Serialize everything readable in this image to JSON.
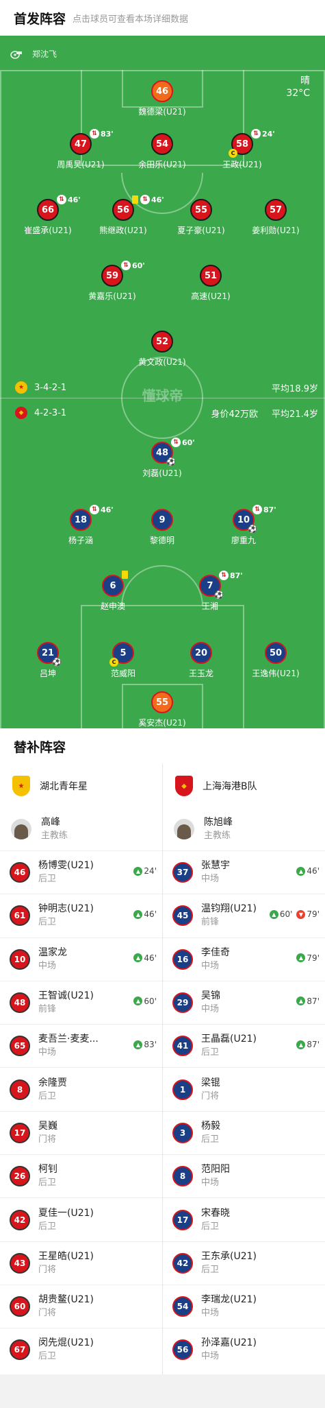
{
  "starting": {
    "title": "首发阵容",
    "hint": "点击球员可查看本场详细数据"
  },
  "referee": {
    "name": "郑沈飞"
  },
  "weather": {
    "condition": "晴",
    "temp": "32°C"
  },
  "home_formation": {
    "shape": "3-4-2-1",
    "avg_age": "平均18.9岁"
  },
  "away_formation": {
    "shape": "4-2-3-1",
    "value": "身价42万欧",
    "avg_age": "平均21.4岁"
  },
  "watermark": "懂球帝",
  "pitch_players": [
    {
      "num": "46",
      "name": "魏德梁(U21)",
      "team": "gk"
    },
    {
      "num": "47",
      "name": "周禹昊(U21)",
      "team": "home",
      "sub_time": "83'"
    },
    {
      "num": "54",
      "name": "余田乐(U21)",
      "team": "home"
    },
    {
      "num": "58",
      "name": "王政(U21)",
      "team": "home",
      "sub_time": "24'",
      "captain": "C"
    },
    {
      "num": "66",
      "name": "崔盛承(U21)",
      "team": "home",
      "sub_time": "46'"
    },
    {
      "num": "56",
      "name": "熊继政(U21)",
      "team": "home",
      "sub_time": "46'",
      "yellow": true
    },
    {
      "num": "55",
      "name": "夏子豪(U21)",
      "team": "home"
    },
    {
      "num": "57",
      "name": "姜利勋(U21)",
      "team": "home"
    },
    {
      "num": "59",
      "name": "黄嘉乐(U21)",
      "team": "home",
      "sub_time": "60'"
    },
    {
      "num": "51",
      "name": "高速(U21)",
      "team": "home"
    },
    {
      "num": "52",
      "name": "黄文政(U21)",
      "team": "home"
    },
    {
      "num": "48",
      "name": "刘磊(U21)",
      "team": "away",
      "sub_time": "60'",
      "goal": true
    },
    {
      "num": "18",
      "name": "杨子涵",
      "team": "away",
      "sub_time": "46'"
    },
    {
      "num": "9",
      "name": "黎德明",
      "team": "away"
    },
    {
      "num": "10",
      "name": "廖重九",
      "team": "away",
      "sub_time": "87'",
      "goal": true
    },
    {
      "num": "6",
      "name": "赵申澳",
      "team": "away",
      "yellow": true
    },
    {
      "num": "7",
      "name": "王湘",
      "team": "away",
      "sub_time": "87'",
      "goal": true
    },
    {
      "num": "21",
      "name": "吕坤",
      "team": "away",
      "goal": true
    },
    {
      "num": "5",
      "name": "范威阳",
      "team": "away",
      "captain": "C"
    },
    {
      "num": "20",
      "name": "王玉龙",
      "team": "away"
    },
    {
      "num": "50",
      "name": "王逸伟(U21)",
      "team": "away"
    },
    {
      "num": "55",
      "name": "奚安杰(U21)",
      "team": "gk"
    }
  ],
  "subs_section": {
    "title": "替补阵容"
  },
  "home_team": {
    "name": "湖北青年星",
    "coach_name": "高峰",
    "coach_role": "主教练",
    "subs": [
      {
        "num": "46",
        "name": "杨博雯(U21)",
        "pos": "后卫",
        "in": "24'"
      },
      {
        "num": "61",
        "name": "钟明志(U21)",
        "pos": "后卫",
        "in": "46'"
      },
      {
        "num": "10",
        "name": "温家龙",
        "pos": "中场",
        "in": "46'"
      },
      {
        "num": "48",
        "name": "王智诚(U21)",
        "pos": "前锋",
        "in": "60'"
      },
      {
        "num": "65",
        "name": "麦吾兰·麦麦...",
        "pos": "中场",
        "in": "83'"
      },
      {
        "num": "8",
        "name": "余隆贾",
        "pos": "后卫"
      },
      {
        "num": "17",
        "name": "吴巍",
        "pos": "门将"
      },
      {
        "num": "26",
        "name": "柯钊",
        "pos": "后卫"
      },
      {
        "num": "42",
        "name": "夏佳一(U21)",
        "pos": "后卫"
      },
      {
        "num": "43",
        "name": "王星皓(U21)",
        "pos": "门将"
      },
      {
        "num": "60",
        "name": "胡贵鳌(U21)",
        "pos": "门将"
      },
      {
        "num": "67",
        "name": "闵先焜(U21)",
        "pos": "后卫"
      }
    ]
  },
  "away_team": {
    "name": "上海海港B队",
    "coach_name": "陈旭峰",
    "coach_role": "主教练",
    "subs": [
      {
        "num": "37",
        "name": "张慧宇",
        "pos": "中场",
        "in": "46'"
      },
      {
        "num": "45",
        "name": "温钧翔(U21)",
        "pos": "前锋",
        "in": "60'",
        "out": "79'"
      },
      {
        "num": "16",
        "name": "李佳奇",
        "pos": "中场",
        "in": "79'"
      },
      {
        "num": "29",
        "name": "吴锦",
        "pos": "中场",
        "in": "87'"
      },
      {
        "num": "41",
        "name": "王晶磊(U21)",
        "pos": "后卫",
        "in": "87'"
      },
      {
        "num": "1",
        "name": "梁锟",
        "pos": "门将"
      },
      {
        "num": "3",
        "name": "杨毅",
        "pos": "后卫"
      },
      {
        "num": "8",
        "name": "范阳阳",
        "pos": "中场"
      },
      {
        "num": "17",
        "name": "宋春晓",
        "pos": "后卫"
      },
      {
        "num": "42",
        "name": "王东承(U21)",
        "pos": "后卫"
      },
      {
        "num": "54",
        "name": "李瑞龙(U21)",
        "pos": "中场"
      },
      {
        "num": "56",
        "name": "孙泽嘉(U21)",
        "pos": "中场"
      }
    ]
  },
  "colors": {
    "pitch": "#3aa84b",
    "home": "#d6151c",
    "away": "#1a3f86",
    "goalkeeper": "#f26a1b"
  }
}
